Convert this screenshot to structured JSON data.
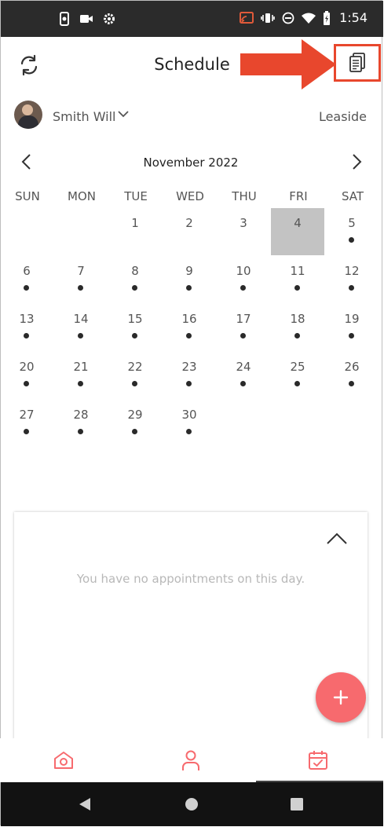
{
  "status_bar": {
    "time": "1:54"
  },
  "header": {
    "title": "Schedule"
  },
  "user": {
    "name": "Smith Will",
    "location": "Leaside"
  },
  "calendar": {
    "month_label": "November 2022",
    "weekdays": [
      "SUN",
      "MON",
      "TUE",
      "WED",
      "THU",
      "FRI",
      "SAT"
    ],
    "selected_day": "4",
    "days": [
      {
        "n": "1",
        "dot": false
      },
      {
        "n": "2",
        "dot": false
      },
      {
        "n": "3",
        "dot": false
      },
      {
        "n": "4",
        "dot": false
      },
      {
        "n": "5",
        "dot": true
      },
      {
        "n": "6",
        "dot": true
      },
      {
        "n": "7",
        "dot": true
      },
      {
        "n": "8",
        "dot": true
      },
      {
        "n": "9",
        "dot": true
      },
      {
        "n": "10",
        "dot": true
      },
      {
        "n": "11",
        "dot": true
      },
      {
        "n": "12",
        "dot": true
      },
      {
        "n": "13",
        "dot": true
      },
      {
        "n": "14",
        "dot": true
      },
      {
        "n": "15",
        "dot": true
      },
      {
        "n": "16",
        "dot": true
      },
      {
        "n": "17",
        "dot": true
      },
      {
        "n": "18",
        "dot": true
      },
      {
        "n": "19",
        "dot": true
      },
      {
        "n": "20",
        "dot": true
      },
      {
        "n": "21",
        "dot": true
      },
      {
        "n": "22",
        "dot": true
      },
      {
        "n": "23",
        "dot": true
      },
      {
        "n": "24",
        "dot": true
      },
      {
        "n": "25",
        "dot": true
      },
      {
        "n": "26",
        "dot": true
      },
      {
        "n": "27",
        "dot": true
      },
      {
        "n": "28",
        "dot": true
      },
      {
        "n": "29",
        "dot": true
      },
      {
        "n": "30",
        "dot": true
      }
    ]
  },
  "appointments": {
    "empty_message": "You have no appointments on this day."
  },
  "bottom_nav": {
    "items": [
      {
        "icon": "home-camera-icon"
      },
      {
        "icon": "person-icon"
      },
      {
        "icon": "calendar-check-icon",
        "active": true
      }
    ]
  },
  "colors": {
    "accent": "#f76a6e",
    "annotation": "#e8472d",
    "selected_day": "#c3c3c3"
  }
}
